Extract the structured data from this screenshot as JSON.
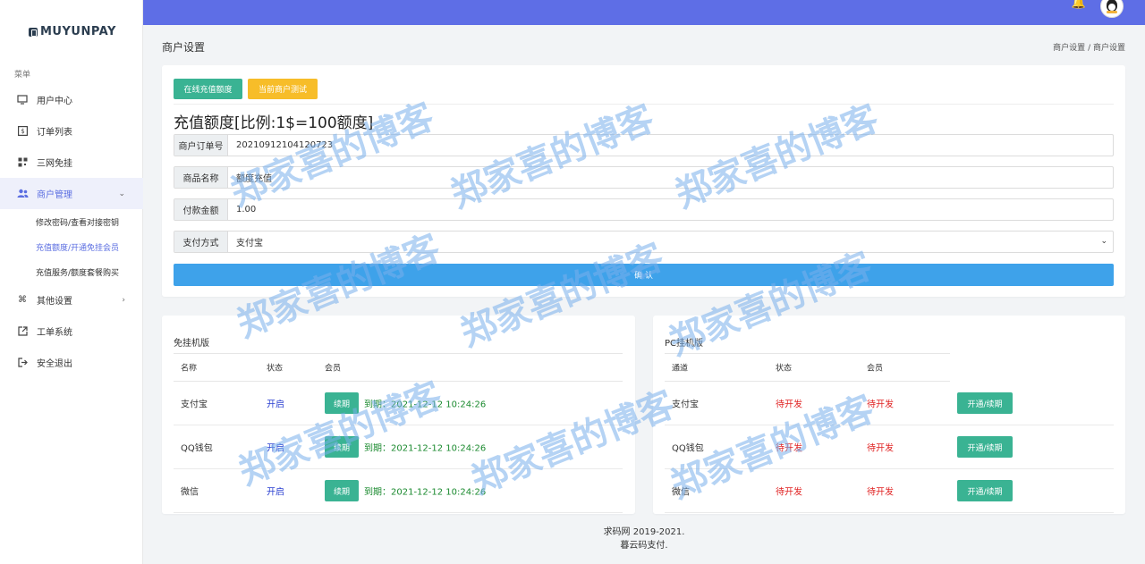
{
  "brand": {
    "logo_text": "MUYUNPAY"
  },
  "sidebar": {
    "menu_title": "菜单",
    "items": [
      {
        "label": "用户中心",
        "icon": "monitor-icon"
      },
      {
        "label": "订单列表",
        "icon": "dollar-icon"
      },
      {
        "label": "三网免挂",
        "icon": "qrcode-icon"
      },
      {
        "label": "商户管理",
        "icon": "users-icon"
      },
      {
        "label": "其他设置",
        "icon": "command-icon"
      },
      {
        "label": "工单系统",
        "icon": "external-icon"
      },
      {
        "label": "安全退出",
        "icon": "logout-icon"
      }
    ],
    "sub_items": [
      {
        "label": "修改密码/查看对接密钥"
      },
      {
        "label": "充值额度/开通免挂会员"
      },
      {
        "label": "充值服务/额度套餐购买"
      }
    ]
  },
  "header": {
    "page_title": "商户设置",
    "breadcrumb": [
      "商户设置",
      "商户设置"
    ],
    "breadcrumb_sep": "/"
  },
  "recharge": {
    "tab_online": "在线充值额度",
    "tab_test": "当前商户测试",
    "title": "充值额度[比例:1$=100额度]",
    "fields": [
      {
        "label": "商户订单号",
        "value": "20210912104120723"
      },
      {
        "label": "商品名称",
        "value": "额度充值"
      },
      {
        "label": "付款金额",
        "value": "1.00"
      },
      {
        "label": "支付方式",
        "value": "支付宝"
      }
    ],
    "submit": "确 认"
  },
  "free_hang": {
    "title": "免挂机版",
    "headers": [
      "名称",
      "状态",
      "会员"
    ],
    "rows": [
      {
        "name": "支付宝",
        "status": "开启",
        "btn": "续期",
        "expire": "到期：2021-12-12 10:24:26"
      },
      {
        "name": "QQ钱包",
        "status": "开启",
        "btn": "续期",
        "expire": "到期：2021-12-12 10:24:26"
      },
      {
        "name": "微信",
        "status": "开启",
        "btn": "续期",
        "expire": "到期：2021-12-12 10:24:26"
      }
    ]
  },
  "pc_hang": {
    "title": "PC挂机版",
    "headers": [
      "通道",
      "状态",
      "会员"
    ],
    "rows": [
      {
        "name": "支付宝",
        "status": "待开发",
        "member": "待开发",
        "btn": "开通/续期"
      },
      {
        "name": "QQ钱包",
        "status": "待开发",
        "member": "待开发",
        "btn": "开通/续期"
      },
      {
        "name": "微信",
        "status": "待开发",
        "member": "待开发",
        "btn": "开通/续期"
      }
    ]
  },
  "footer": {
    "line1": "求码网 2019-2021.",
    "line2": "暮云码支付."
  },
  "watermark": "郑家喜的博客",
  "colors": {
    "topbar": "#5e6ee6",
    "accent": "#5b6ee1",
    "green": "#3ab393",
    "yellow": "#f7bd29",
    "blue": "#3ea2ea"
  }
}
